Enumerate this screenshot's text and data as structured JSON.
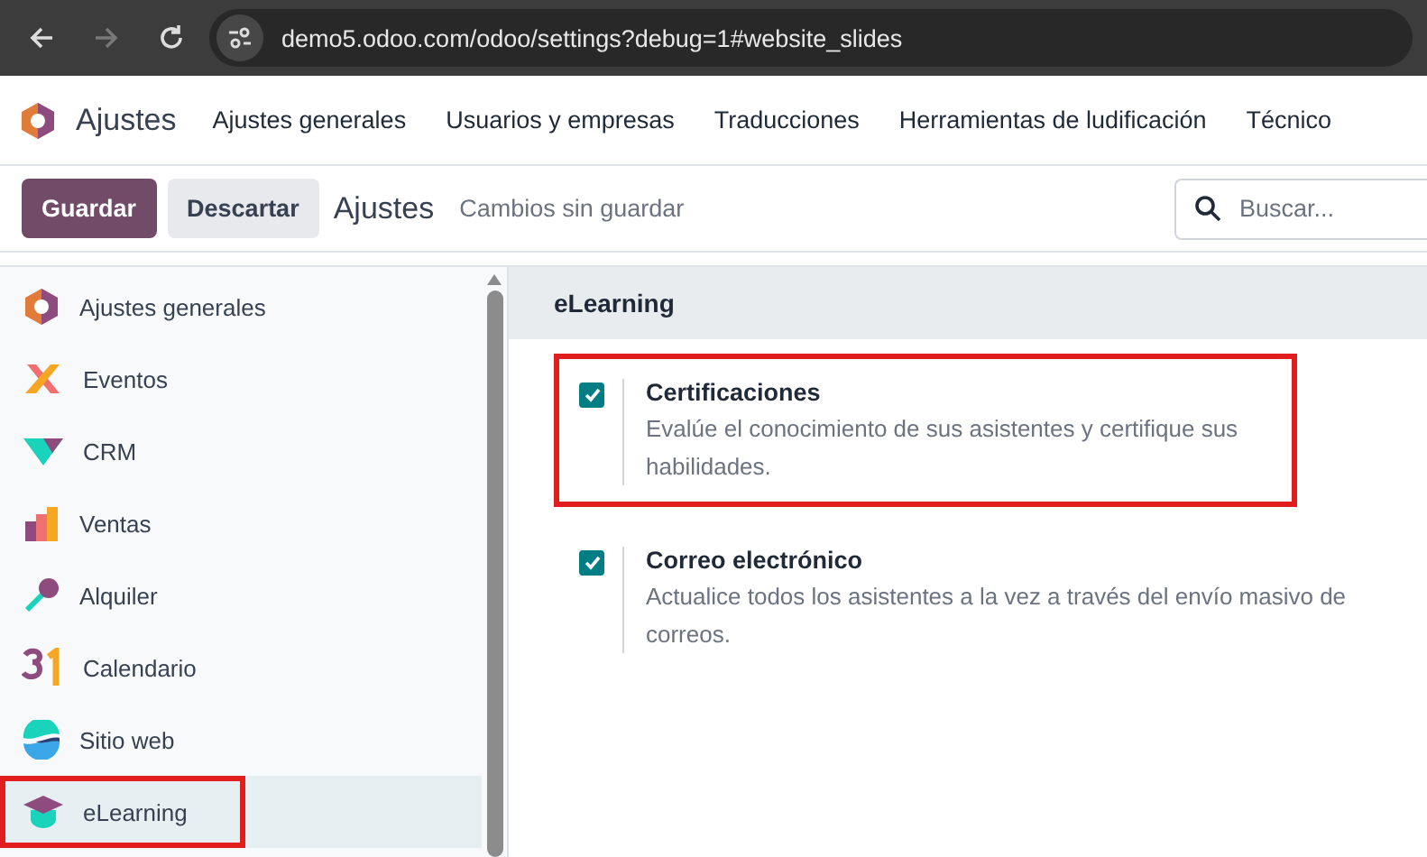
{
  "browser": {
    "url": "demo5.odoo.com/odoo/settings?debug=1#website_slides"
  },
  "navbar": {
    "app": "Ajustes",
    "menus": [
      "Ajustes generales",
      "Usuarios y empresas",
      "Traducciones",
      "Herramientas de ludificación",
      "Técnico"
    ]
  },
  "control_panel": {
    "save": "Guardar",
    "discard": "Descartar",
    "title": "Ajustes",
    "status": "Cambios sin guardar",
    "search": {
      "placeholder": "Buscar..."
    }
  },
  "sidebar": {
    "items": [
      {
        "label": "Ajustes generales",
        "selected": false,
        "highlighted": false
      },
      {
        "label": "Eventos",
        "selected": false,
        "highlighted": false
      },
      {
        "label": "CRM",
        "selected": false,
        "highlighted": false
      },
      {
        "label": "Ventas",
        "selected": false,
        "highlighted": false
      },
      {
        "label": "Alquiler",
        "selected": false,
        "highlighted": false
      },
      {
        "label": "Calendario",
        "selected": false,
        "highlighted": false
      },
      {
        "label": "Sitio web",
        "selected": false,
        "highlighted": false
      },
      {
        "label": "eLearning",
        "selected": true,
        "highlighted": true
      }
    ]
  },
  "section": {
    "title": "eLearning",
    "settings": [
      {
        "title": "Certificaciones",
        "description": "Evalúe el conocimiento de sus asistentes y certifique sus habilidades.",
        "checked": true,
        "highlighted": true
      },
      {
        "title": "Correo electrónico",
        "description": "Actualice todos los asistentes a la vez a través del envío masivo de correos.",
        "checked": true,
        "highlighted": false
      }
    ]
  }
}
